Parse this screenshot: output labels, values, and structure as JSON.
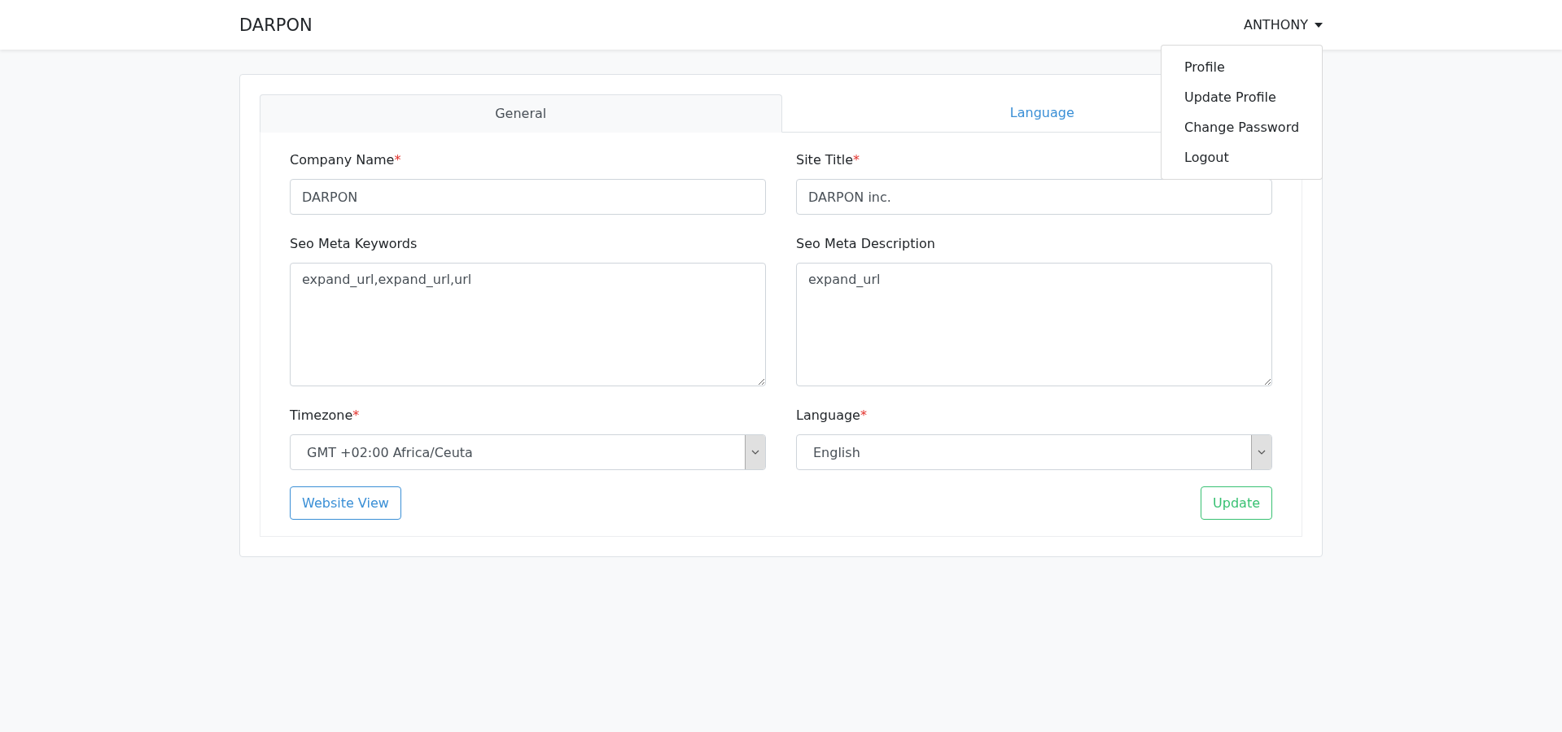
{
  "navbar": {
    "brand": "DARPON",
    "user": "ANTHONY",
    "user_menu_open": true
  },
  "user_menu": [
    {
      "label": "Profile"
    },
    {
      "label": "Update Profile"
    },
    {
      "label": "Change Password"
    },
    {
      "label": "Logout"
    }
  ],
  "tabs": [
    {
      "label": "General",
      "selected": true
    },
    {
      "label": "Language",
      "selected": false
    }
  ],
  "fields": [
    {
      "kind": "input",
      "label": "Company Name",
      "required_mark": "*",
      "value": "DARPON"
    },
    {
      "kind": "input",
      "label": "Site Title",
      "required_mark": "*",
      "value": "DARPON inc."
    },
    {
      "kind": "textarea",
      "label": "Seo Meta Keywords",
      "value": "expand_url,expand_url,url"
    },
    {
      "kind": "textarea",
      "label": "Seo Meta Description",
      "value": "expand_url"
    },
    {
      "kind": "select",
      "label": "Timezone",
      "required_mark": "*",
      "value": "GMT +02:00 Africa/Ceuta"
    },
    {
      "kind": "select",
      "label": "Language",
      "required_mark": "*",
      "value": "English"
    }
  ],
  "buttons": [
    {
      "label": "Website View",
      "kind": "secondary"
    },
    {
      "label": "Update",
      "kind": "primary"
    }
  ]
}
